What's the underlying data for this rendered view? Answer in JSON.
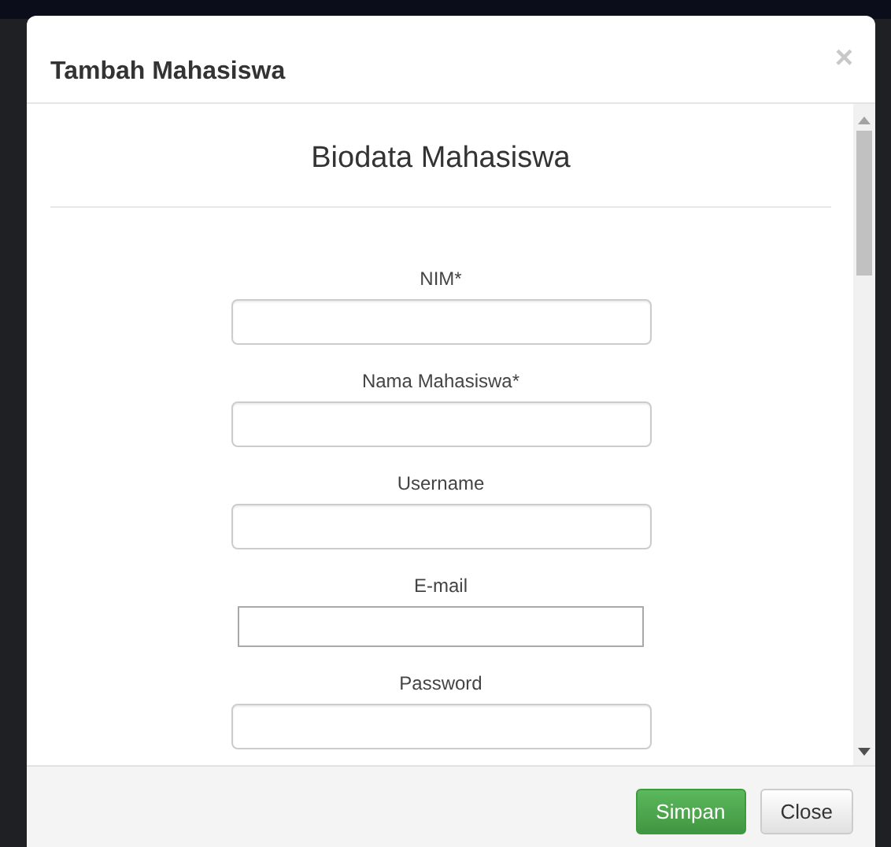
{
  "modal": {
    "title": "Tambah Mahasiswa",
    "close_icon": "×"
  },
  "section_title": "Biodata Mahasiswa",
  "fields": [
    {
      "label": "NIM*",
      "kind": "rounded"
    },
    {
      "label": "Nama Mahasiswa*",
      "kind": "rounded"
    },
    {
      "label": "Username",
      "kind": "rounded"
    },
    {
      "label": "E-mail",
      "kind": "plain"
    },
    {
      "label": "Password",
      "kind": "rounded"
    }
  ],
  "buttons": [
    {
      "label": "Simpan",
      "kind": "primary"
    },
    {
      "label": "Close",
      "kind": "default"
    }
  ]
}
